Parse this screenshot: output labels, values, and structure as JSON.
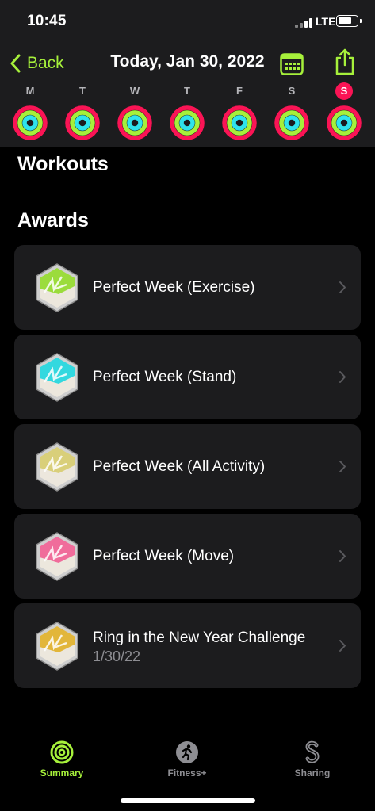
{
  "status": {
    "time": "10:45",
    "network": "LTE"
  },
  "nav": {
    "back_label": "Back",
    "title": "Today, Jan 30, 2022"
  },
  "week": {
    "days": [
      "M",
      "T",
      "W",
      "T",
      "F",
      "S",
      "S"
    ],
    "today_index": 6
  },
  "rings": {
    "move": "#fa1455",
    "exercise": "#a6f03b",
    "stand": "#2fe3ec",
    "move_track": "#4a0f22",
    "exercise_track": "#2e4a0e",
    "stand_track": "#0f4346"
  },
  "sections": {
    "workouts": "Workouts",
    "awards": "Awards"
  },
  "awards": [
    {
      "label": "Perfect Week (Exercise)",
      "sub": "",
      "badge": "hex-exercise",
      "color": "#9bdc3c"
    },
    {
      "label": "Perfect Week (Stand)",
      "sub": "",
      "badge": "hex-stand",
      "color": "#32d8df"
    },
    {
      "label": "Perfect Week (All Activity)",
      "sub": "",
      "badge": "hex-all",
      "color": "#d9cf7a"
    },
    {
      "label": "Perfect Week (Move)",
      "sub": "",
      "badge": "hex-move",
      "color": "#f06c9b"
    },
    {
      "label": "Ring in the New Year Challenge",
      "sub": "1/30/22",
      "badge": "hex-newyear",
      "color": "#e2b63a"
    }
  ],
  "tabs": [
    {
      "label": "Summary",
      "icon": "activity-rings-icon",
      "active": true
    },
    {
      "label": "Fitness+",
      "icon": "running-figure-icon",
      "active": false
    },
    {
      "label": "Sharing",
      "icon": "sharing-s-icon",
      "active": false
    }
  ],
  "colors": {
    "accent": "#a6f03b",
    "background": "#000000",
    "card": "#1c1c1e",
    "secondary_text": "#8e8e93"
  }
}
